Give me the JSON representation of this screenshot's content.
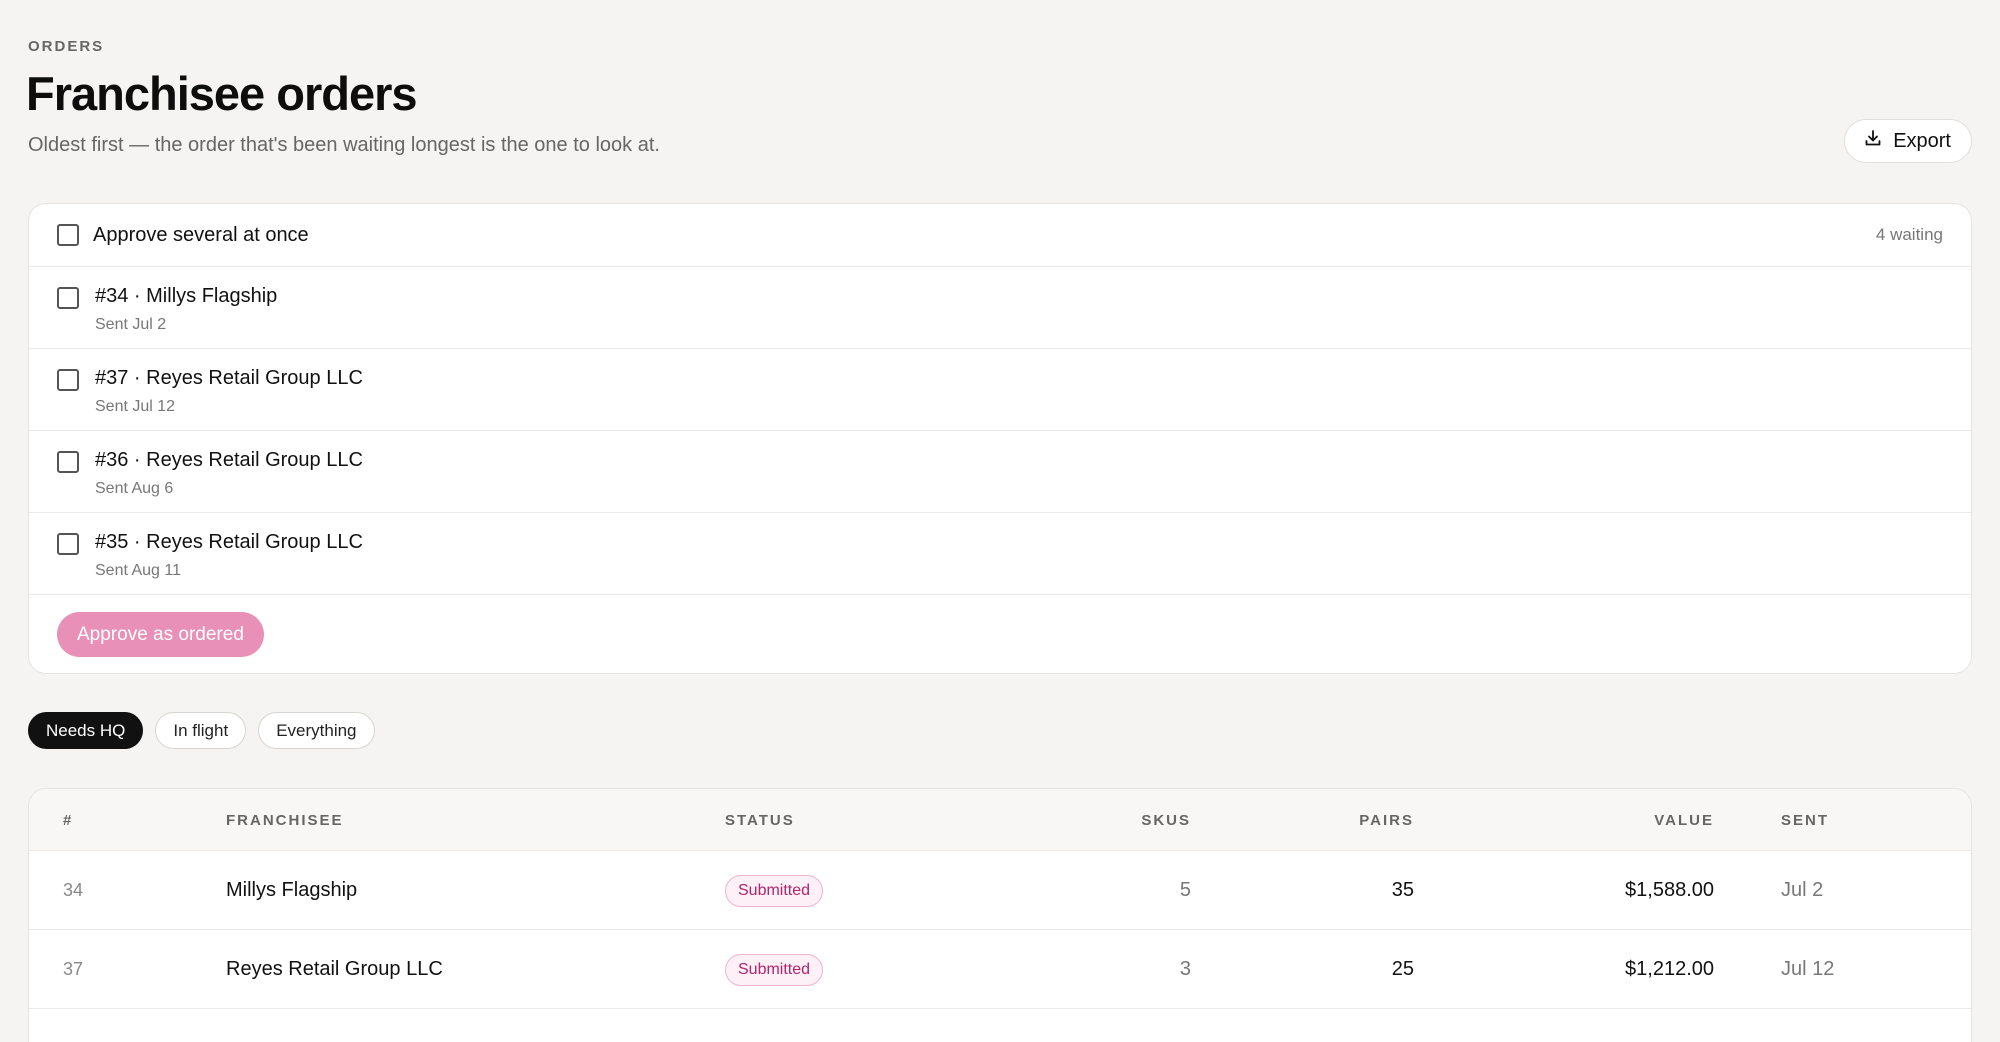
{
  "header": {
    "eyebrow": "ORDERS",
    "title": "Franchisee orders",
    "subtitle": "Oldest first — the order that's been waiting longest is the one to look at.",
    "export_label": "Export",
    "export_icon": "download-icon"
  },
  "batch": {
    "select_all_label": "Approve several at once",
    "waiting_count": "4 waiting",
    "items": [
      {
        "label": "#34 · Millys Flagship",
        "sent": "Sent Jul 2"
      },
      {
        "label": "#37 · Reyes Retail Group LLC",
        "sent": "Sent Jul 12"
      },
      {
        "label": "#36 · Reyes Retail Group LLC",
        "sent": "Sent Aug 6"
      },
      {
        "label": "#35 · Reyes Retail Group LLC",
        "sent": "Sent Aug 11"
      }
    ],
    "approve_label": "Approve as ordered"
  },
  "filters": {
    "chips": [
      {
        "label": "Needs HQ",
        "active": true
      },
      {
        "label": "In flight",
        "active": false
      },
      {
        "label": "Everything",
        "active": false
      }
    ]
  },
  "table": {
    "columns": [
      "#",
      "FRANCHISEE",
      "STATUS",
      "SKUS",
      "PAIRS",
      "VALUE",
      "SENT"
    ],
    "rows": [
      {
        "num": "34",
        "franchisee": "Millys Flagship",
        "status": "Submitted",
        "skus": "5",
        "pairs": "35",
        "value": "$1,588.00",
        "sent": "Jul 2"
      },
      {
        "num": "37",
        "franchisee": "Reyes Retail Group LLC",
        "status": "Submitted",
        "skus": "3",
        "pairs": "25",
        "value": "$1,212.00",
        "sent": "Jul 12"
      },
      {
        "num": "",
        "franchisee": "",
        "status": "",
        "skus": "",
        "pairs": "",
        "value": "",
        "sent": ""
      }
    ]
  },
  "colors": {
    "accent_pink": "#e890b8",
    "badge_text": "#b3246b",
    "active_chip": "#111111"
  }
}
